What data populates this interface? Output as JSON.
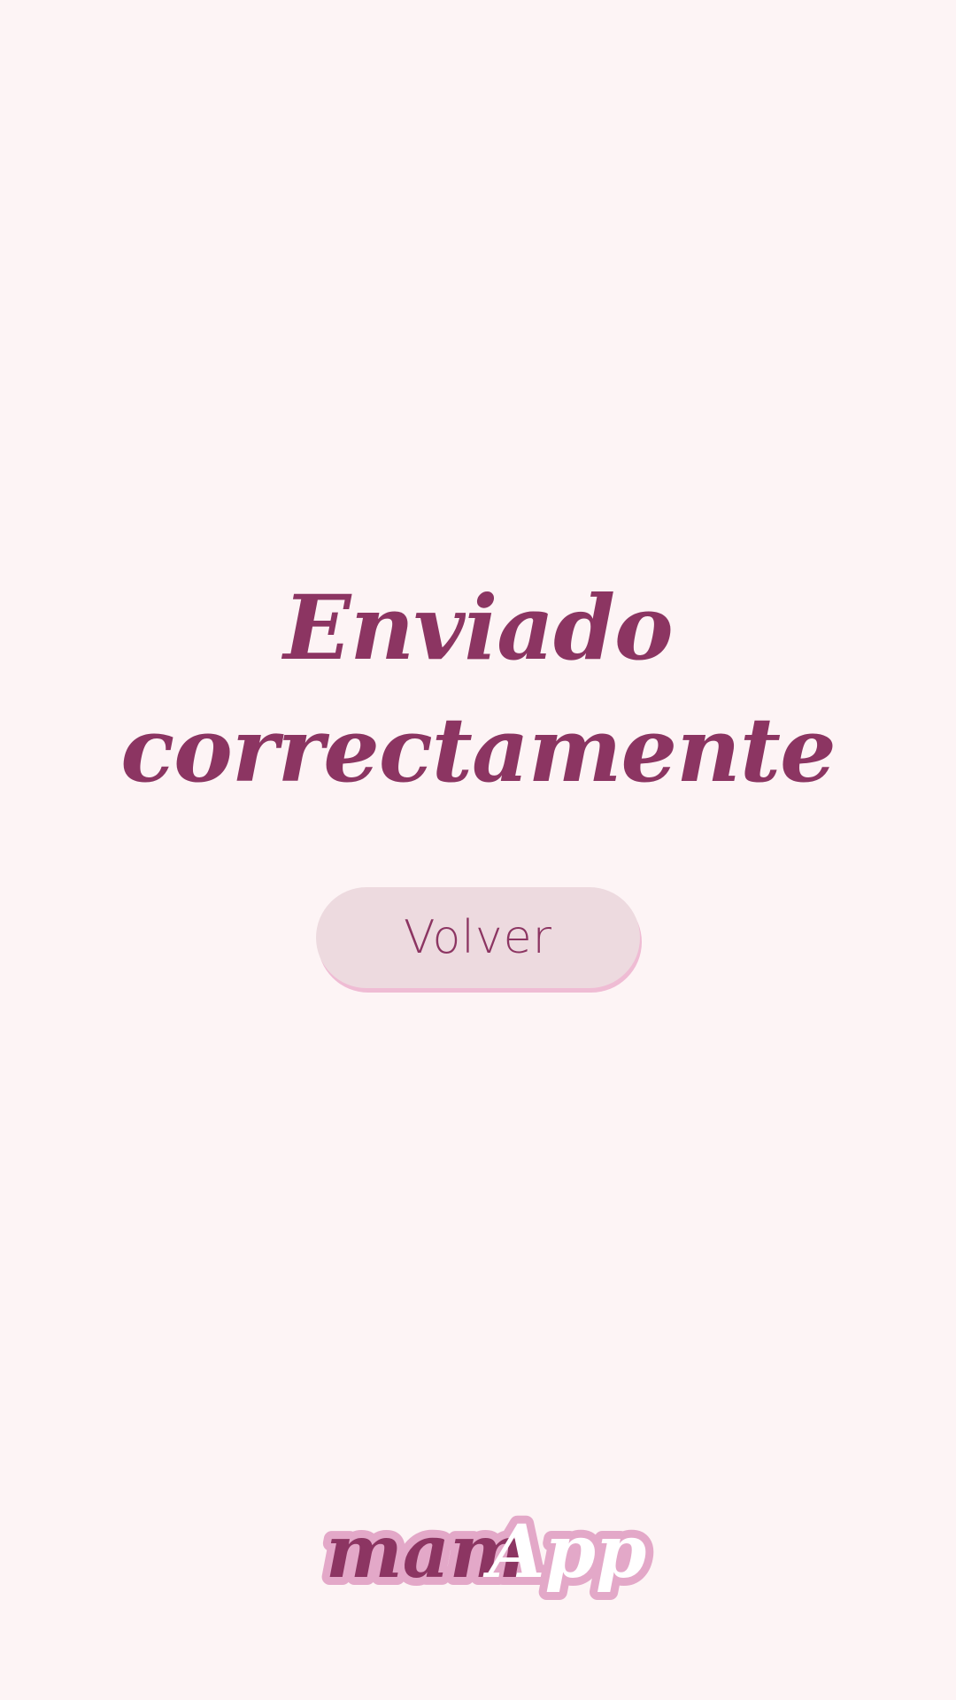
{
  "message": {
    "line1": "Enviado",
    "line2": "correctamente"
  },
  "back_button": {
    "label": "Volver"
  },
  "logo": {
    "part1": "mam",
    "part2": "App"
  },
  "colors": {
    "background": "#fdf4f5",
    "primary": "#8c3562",
    "button_bg": "#eddadf",
    "button_shadow": "#efbcd4",
    "logo_outline": "#e3a8c8"
  }
}
